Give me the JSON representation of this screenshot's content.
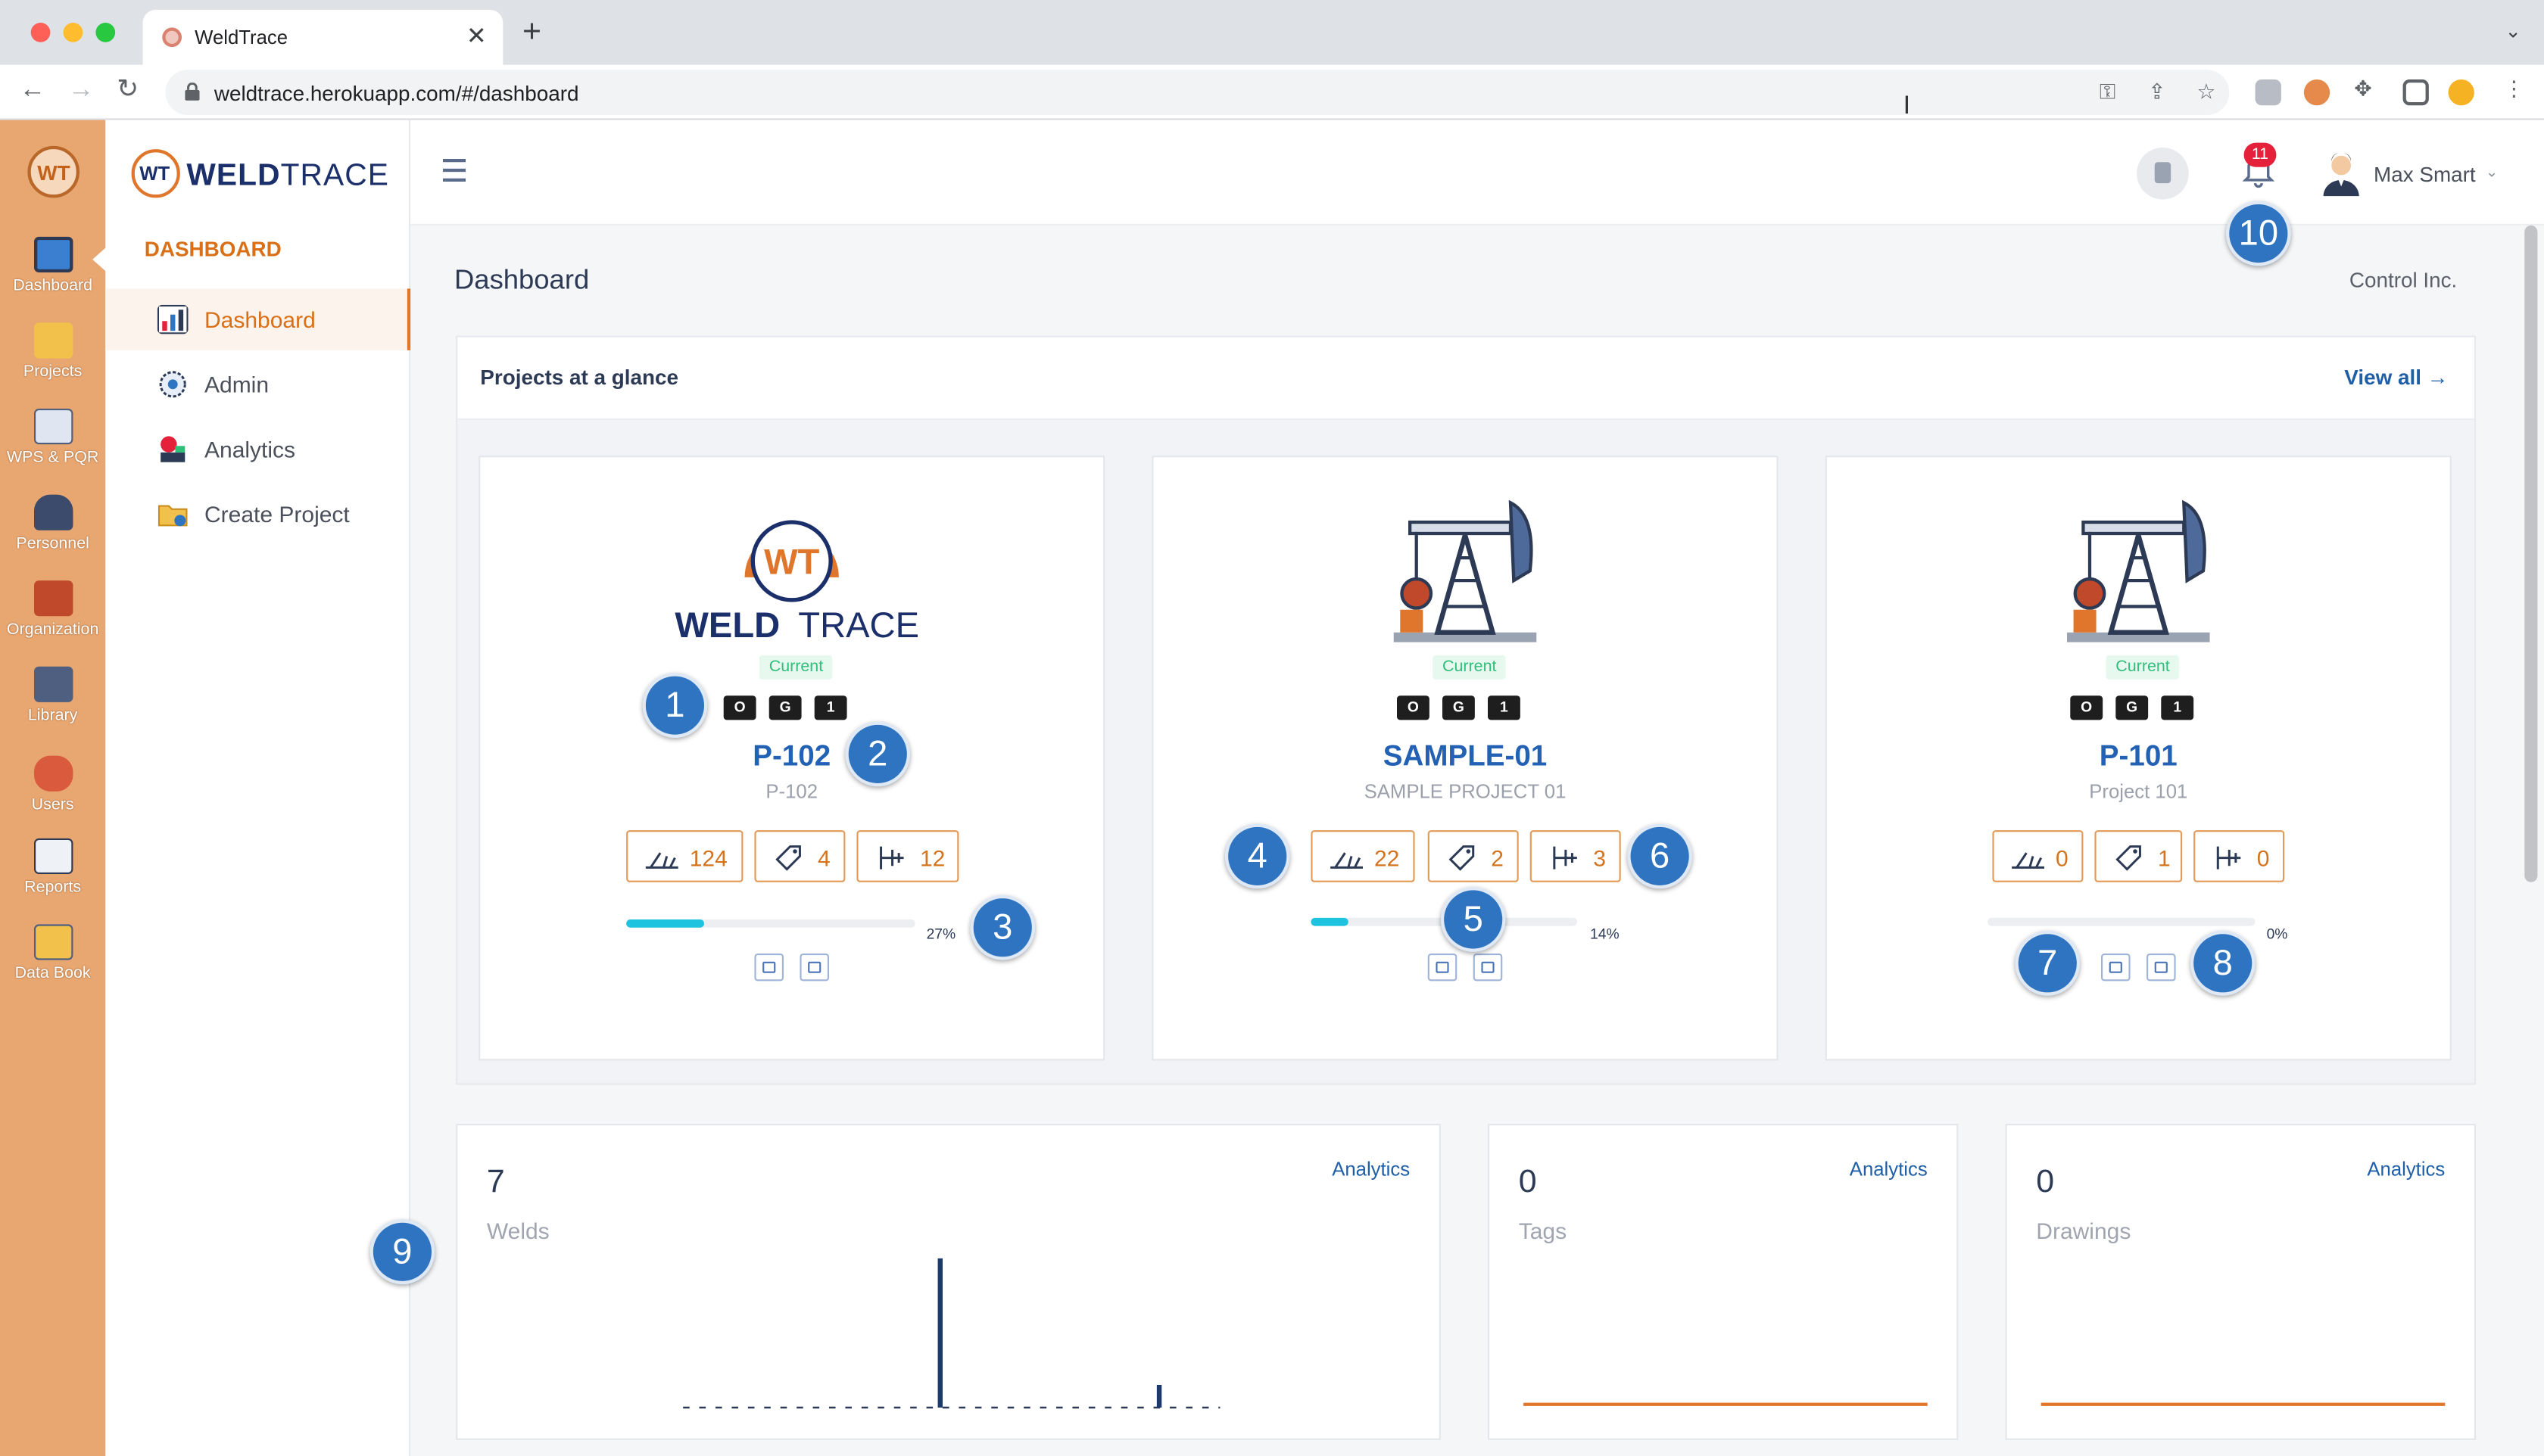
{
  "browser": {
    "tab_title": "WeldTrace",
    "tab_close": "✕",
    "new_tab": "+",
    "url": "weldtrace.herokuapp.com/#/dashboard"
  },
  "rail": {
    "logo": "WT",
    "items": [
      {
        "label": "Dashboard",
        "icon": "monitor-icon",
        "color": "#3a7fd0"
      },
      {
        "label": "Projects",
        "icon": "folder-icon",
        "color": "#f2c14b"
      },
      {
        "label": "WPS & PQR",
        "icon": "clipboard-icon",
        "color": "#dfe6f2"
      },
      {
        "label": "Personnel",
        "icon": "welder-icon",
        "color": "#3c4a6b"
      },
      {
        "label": "Organization",
        "icon": "org-chart-icon",
        "color": "#c0492b"
      },
      {
        "label": "Library",
        "icon": "books-icon",
        "color": "#4e5f7f"
      },
      {
        "label": "Users",
        "icon": "users-icon",
        "color": "#d95a3c"
      },
      {
        "label": "Reports",
        "icon": "report-icon",
        "color": "#eef1f6"
      },
      {
        "label": "Data Book",
        "icon": "databook-icon",
        "color": "#f2c14b"
      }
    ]
  },
  "sidebar": {
    "brand_prefix": "WELD",
    "brand_suffix": "TRACE",
    "brand_mark": "WT",
    "section": "DASHBOARD",
    "items": [
      {
        "label": "Dashboard",
        "icon": "chart-icon",
        "active": true
      },
      {
        "label": "Admin",
        "icon": "gear-icon",
        "active": false
      },
      {
        "label": "Analytics",
        "icon": "analytics-icon",
        "active": false
      },
      {
        "label": "Create Project",
        "icon": "folder-add-icon",
        "active": false
      }
    ]
  },
  "header": {
    "notification_count": "11",
    "user_name": "Max Smart",
    "caret": "⌄"
  },
  "main": {
    "title": "Dashboard",
    "company": "Control Inc.",
    "panel_title": "Projects at a glance",
    "view_all": "View all →"
  },
  "projects": [
    {
      "code": "P-102",
      "name": "P-102",
      "status": "Current",
      "logo": "weldtrace-logo",
      "mini": [
        "O",
        "G",
        "1"
      ],
      "welds": "124",
      "tags": "4",
      "drawings": "12",
      "progress": 0.27,
      "progress_label": "27%"
    },
    {
      "code": "SAMPLE-01",
      "name": "SAMPLE PROJECT 01",
      "status": "Current",
      "logo": "pumpjack-icon",
      "mini": [
        "O",
        "G",
        "1"
      ],
      "welds": "22",
      "tags": "2",
      "drawings": "3",
      "progress": 0.14,
      "progress_label": "14%"
    },
    {
      "code": "P-101",
      "name": "Project 101",
      "status": "Current",
      "logo": "pumpjack-icon",
      "mini": [
        "O",
        "G",
        "1"
      ],
      "welds": "0",
      "tags": "1",
      "drawings": "0",
      "progress": 0.0,
      "progress_label": "0%"
    }
  ],
  "logo_text": {
    "weld": "WELD",
    "trace": "TRACE",
    "mark": "WT"
  },
  "kpis": [
    {
      "value": "7",
      "label": "Welds",
      "link": "Analytics"
    },
    {
      "value": "0",
      "label": "Tags",
      "link": "Analytics"
    },
    {
      "value": "0",
      "label": "Drawings",
      "link": "Analytics"
    }
  ],
  "callouts": [
    "1",
    "2",
    "3",
    "4",
    "5",
    "6",
    "7",
    "8",
    "9",
    "10"
  ],
  "colors": {
    "accent": "#d96f16",
    "link": "#1f5fa8",
    "rail": "#e8a671",
    "progress": "#1ec3e0",
    "callout": "#2f74c0"
  }
}
